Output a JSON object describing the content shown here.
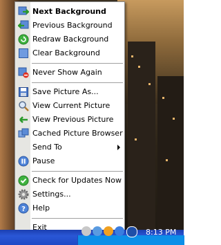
{
  "menu": {
    "items": [
      {
        "label": "Next Background",
        "icon": "next-background-icon"
      },
      {
        "label": "Previous Background",
        "icon": "previous-background-icon"
      },
      {
        "label": "Redraw Background",
        "icon": "redraw-icon"
      },
      {
        "label": "Clear Background",
        "icon": "clear-background-icon"
      },
      {
        "label": "Never Show Again",
        "icon": "never-show-icon"
      },
      {
        "label": "Save Picture As...",
        "icon": "save-icon"
      },
      {
        "label": "View Current Picture",
        "icon": "magnifier-icon"
      },
      {
        "label": "View Previous Picture",
        "icon": "view-previous-icon"
      },
      {
        "label": "Cached Picture Browser",
        "icon": "picture-browser-icon"
      },
      {
        "label": "Send To",
        "icon": "none"
      },
      {
        "label": "Pause",
        "icon": "pause-icon"
      },
      {
        "label": "Check for Updates Now",
        "icon": "check-icon"
      },
      {
        "label": "Settings...",
        "icon": "gear-icon"
      },
      {
        "label": "Help",
        "icon": "help-icon"
      },
      {
        "label": "Exit",
        "icon": "none"
      }
    ]
  },
  "taskbar": {
    "clock": "8:13 PM"
  },
  "colors": {
    "menu_bg": "#ffffff",
    "gutter": "#e6e6e2",
    "taskbar": "#2a57d6",
    "tray": "#0c8fe8"
  }
}
